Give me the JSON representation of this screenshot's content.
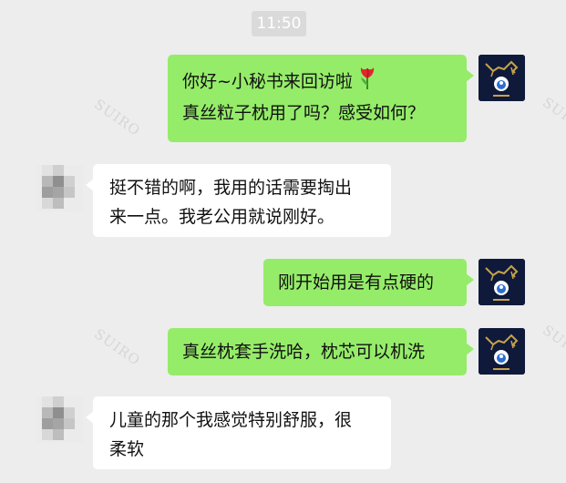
{
  "timestamp": "11:50",
  "watermark": "SUIRO",
  "messages": [
    {
      "side": "out",
      "lines": [
        "你好~小秘书来回访啦",
        "真丝粒子枕用了吗？感受如何？"
      ],
      "emoji": "tulip-icon"
    },
    {
      "side": "in",
      "lines": [
        "挺不错的啊，我用的话需要掏出",
        "来一点。我老公用就说刚好。"
      ]
    },
    {
      "side": "out",
      "lines": [
        "刚开始用是有点硬的"
      ]
    },
    {
      "side": "out",
      "lines": [
        "真丝枕套手洗哈，枕芯可以机洗"
      ]
    },
    {
      "side": "in",
      "lines": [
        "儿童的那个我感觉特别舒服，很",
        "柔软"
      ]
    }
  ],
  "colors": {
    "background": "#ededed",
    "outgoing_bubble": "#95ec69",
    "incoming_bubble": "#ffffff",
    "brand_avatar": "#0f1a3a"
  }
}
